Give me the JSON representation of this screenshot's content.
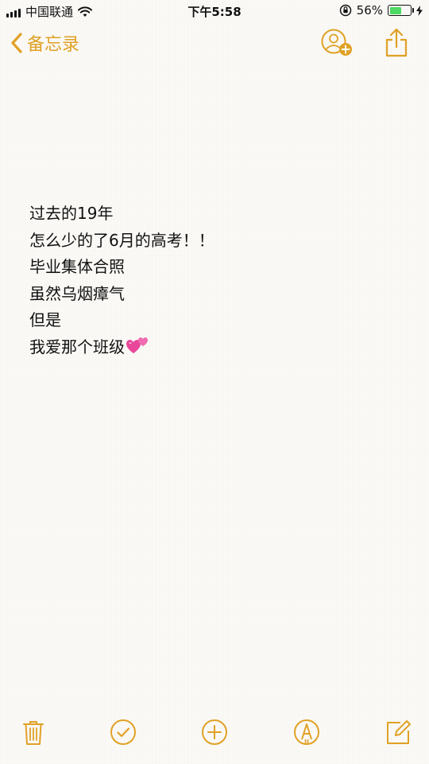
{
  "status_bar": {
    "carrier": "中国联通",
    "time": "下午5:58",
    "battery_percent": "56%",
    "battery_level": 0.56,
    "icons": [
      "signal-icon",
      "wifi-icon",
      "orientation-lock-icon",
      "battery-icon",
      "charging-icon"
    ]
  },
  "nav": {
    "back_label": "备忘录",
    "icons": [
      "chevron-left-icon",
      "add-people-icon",
      "share-icon"
    ]
  },
  "note": {
    "lines": [
      "过去的19年",
      "怎么少的了6月的高考！！",
      "毕业集体合照",
      "虽然乌烟瘴气",
      "但是",
      "我爱那个班级"
    ],
    "emoji": "two-hearts-icon"
  },
  "toolbar": {
    "icons": [
      "trash-icon",
      "checklist-icon",
      "add-icon",
      "markup-icon",
      "compose-icon"
    ]
  },
  "colors": {
    "accent": "#e0a125",
    "text": "#111111",
    "background": "#fbfaf7",
    "battery": "#4cd964",
    "heart": "#e8479a"
  }
}
